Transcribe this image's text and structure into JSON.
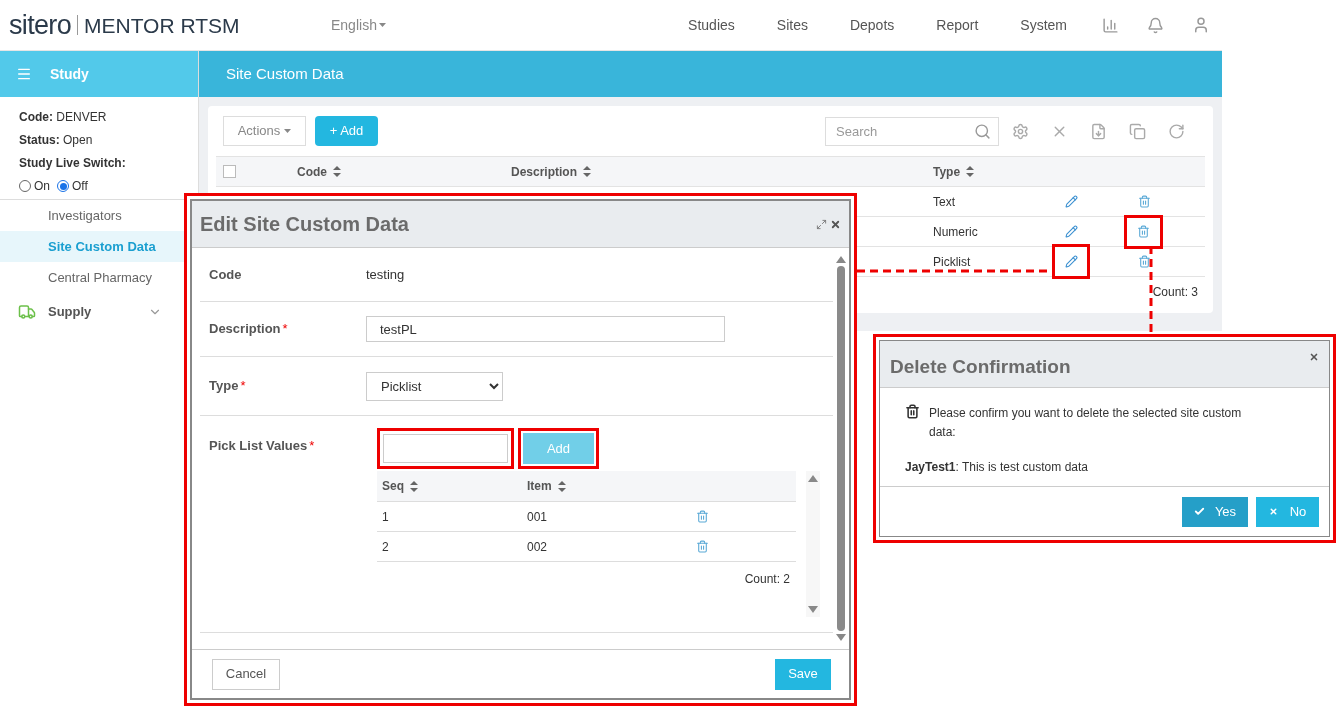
{
  "header": {
    "logo_brand": "sitero",
    "logo_product": "MENTOR RTSM",
    "language": "English",
    "nav": [
      "Studies",
      "Sites",
      "Depots",
      "Report",
      "System"
    ]
  },
  "sidebar": {
    "title": "Study",
    "info": [
      {
        "label": "Code:",
        "value": "DENVER"
      },
      {
        "label": "Status:",
        "value": "Open"
      }
    ],
    "live_switch": {
      "label": "Study Live Switch:",
      "options": [
        {
          "label": "On",
          "selected": false
        },
        {
          "label": "Off",
          "selected": true
        }
      ]
    },
    "items": [
      {
        "label": "Investigators",
        "kind": "sub",
        "selected": false
      },
      {
        "label": "Site Custom Data",
        "kind": "sub",
        "selected": true
      },
      {
        "label": "Central Pharmacy",
        "kind": "sub",
        "selected": false
      },
      {
        "label": "Supply",
        "kind": "group",
        "selected": false
      }
    ]
  },
  "page_title": "Site Custom Data",
  "toolbar": {
    "actions": "Actions",
    "add": "+ Add",
    "search_placeholder": "Search"
  },
  "table": {
    "select_all": {
      "checked": false
    },
    "columns": [
      "Code",
      "Description",
      "Type"
    ],
    "rows": [
      {
        "type": "Text",
        "highlight_edit": false,
        "highlight_delete": false
      },
      {
        "type": "Numeric",
        "highlight_edit": false,
        "highlight_delete": true
      },
      {
        "type": "Picklist",
        "highlight_edit": true,
        "highlight_delete": false
      }
    ],
    "count": "Count: 3"
  },
  "edit_dialog": {
    "title": "Edit Site Custom Data",
    "required_mark": "*",
    "code": {
      "label": "Code",
      "value": "testing"
    },
    "description": {
      "label": "Description",
      "required": true,
      "value": "testPL"
    },
    "type": {
      "label": "Type",
      "required": true,
      "value": "Picklist"
    },
    "picklist": {
      "label": "Pick List Values",
      "required": true,
      "add": "Add",
      "columns": [
        "Seq",
        "Item"
      ],
      "rows": [
        {
          "seq": "1",
          "item": "001"
        },
        {
          "seq": "2",
          "item": "002"
        }
      ],
      "count": "Count: 2"
    },
    "cancel": "Cancel",
    "save": "Save"
  },
  "delete_dialog": {
    "title": "Delete Confirmation",
    "message": "Please confirm you want to delete the selected site custom data:",
    "item": "**JayTest1**: This is test custom data",
    "yes": "Yes",
    "no": "No"
  }
}
